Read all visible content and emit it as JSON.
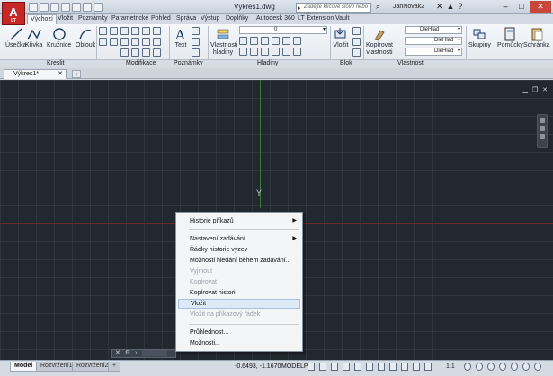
{
  "app": {
    "logo_letter": "A",
    "logo_sub": "LT"
  },
  "window": {
    "title": "Výkres1.dwg"
  },
  "search": {
    "placeholder": "Zadejte klíčové slovo nebo výraz"
  },
  "user": {
    "name": "JanNovak2"
  },
  "ribbon_tabs": [
    "Výchozí",
    "Vložit",
    "Poznámky",
    "Parametrické",
    "Pohled",
    "Správa",
    "Výstup",
    "Doplňky",
    "Autodesk 360",
    "LT Extension",
    "Vault"
  ],
  "ribbon": {
    "tools": {
      "line": "Úsečka",
      "polyline": "Křivka",
      "circle": "Kružnice",
      "arc": "Oblouk",
      "text": "Text",
      "layer_props": "Vlastnosti hladiny",
      "insert": "Vložit",
      "match_props": "Kopírovat vlastnosti",
      "groups": "Skupiny",
      "utilities": "Pomůcky",
      "clipboard": "Schránka"
    },
    "layer_value": "0",
    "prop_values": [
      "DleHlad",
      "DleHlad",
      "DleHlad"
    ],
    "panels": [
      "Kreslit",
      "Modifikace",
      "Poznámky",
      "Hladiny",
      "Blok",
      "Vlastnosti"
    ]
  },
  "file_tab": {
    "label": "Výkres1*"
  },
  "canvas": {
    "y_axis_label": "Y"
  },
  "context_menu": {
    "items": [
      {
        "label": "Historie příkazů",
        "disabled": false,
        "submenu": true
      },
      {
        "label": "Nastavení zadávání",
        "disabled": false,
        "submenu": true
      },
      {
        "label": "Řádky historie výzev",
        "disabled": false,
        "submenu": false
      },
      {
        "label": "Možnosti hledání během zadávání...",
        "disabled": false,
        "submenu": false
      },
      {
        "label": "Vyjmout",
        "disabled": true,
        "submenu": false
      },
      {
        "label": "Kopírovat",
        "disabled": true,
        "submenu": false
      },
      {
        "label": "Kopírovat historii",
        "disabled": false,
        "submenu": false
      },
      {
        "label": "Vložit",
        "disabled": false,
        "submenu": false,
        "highlighted": true
      },
      {
        "label": "Vložit na příkazový řádek",
        "disabled": true,
        "submenu": false
      },
      {
        "label": "Průhlednost...",
        "disabled": false,
        "submenu": false
      },
      {
        "label": "Možnosti...",
        "disabled": false,
        "submenu": false
      }
    ]
  },
  "statusbar": {
    "layout_tabs": [
      "Model",
      "Rozvržení1",
      "Rozvržení2"
    ],
    "coordinates": "-0.6493, -1.1670",
    "space": "MODELP",
    "scale": "1:1"
  }
}
